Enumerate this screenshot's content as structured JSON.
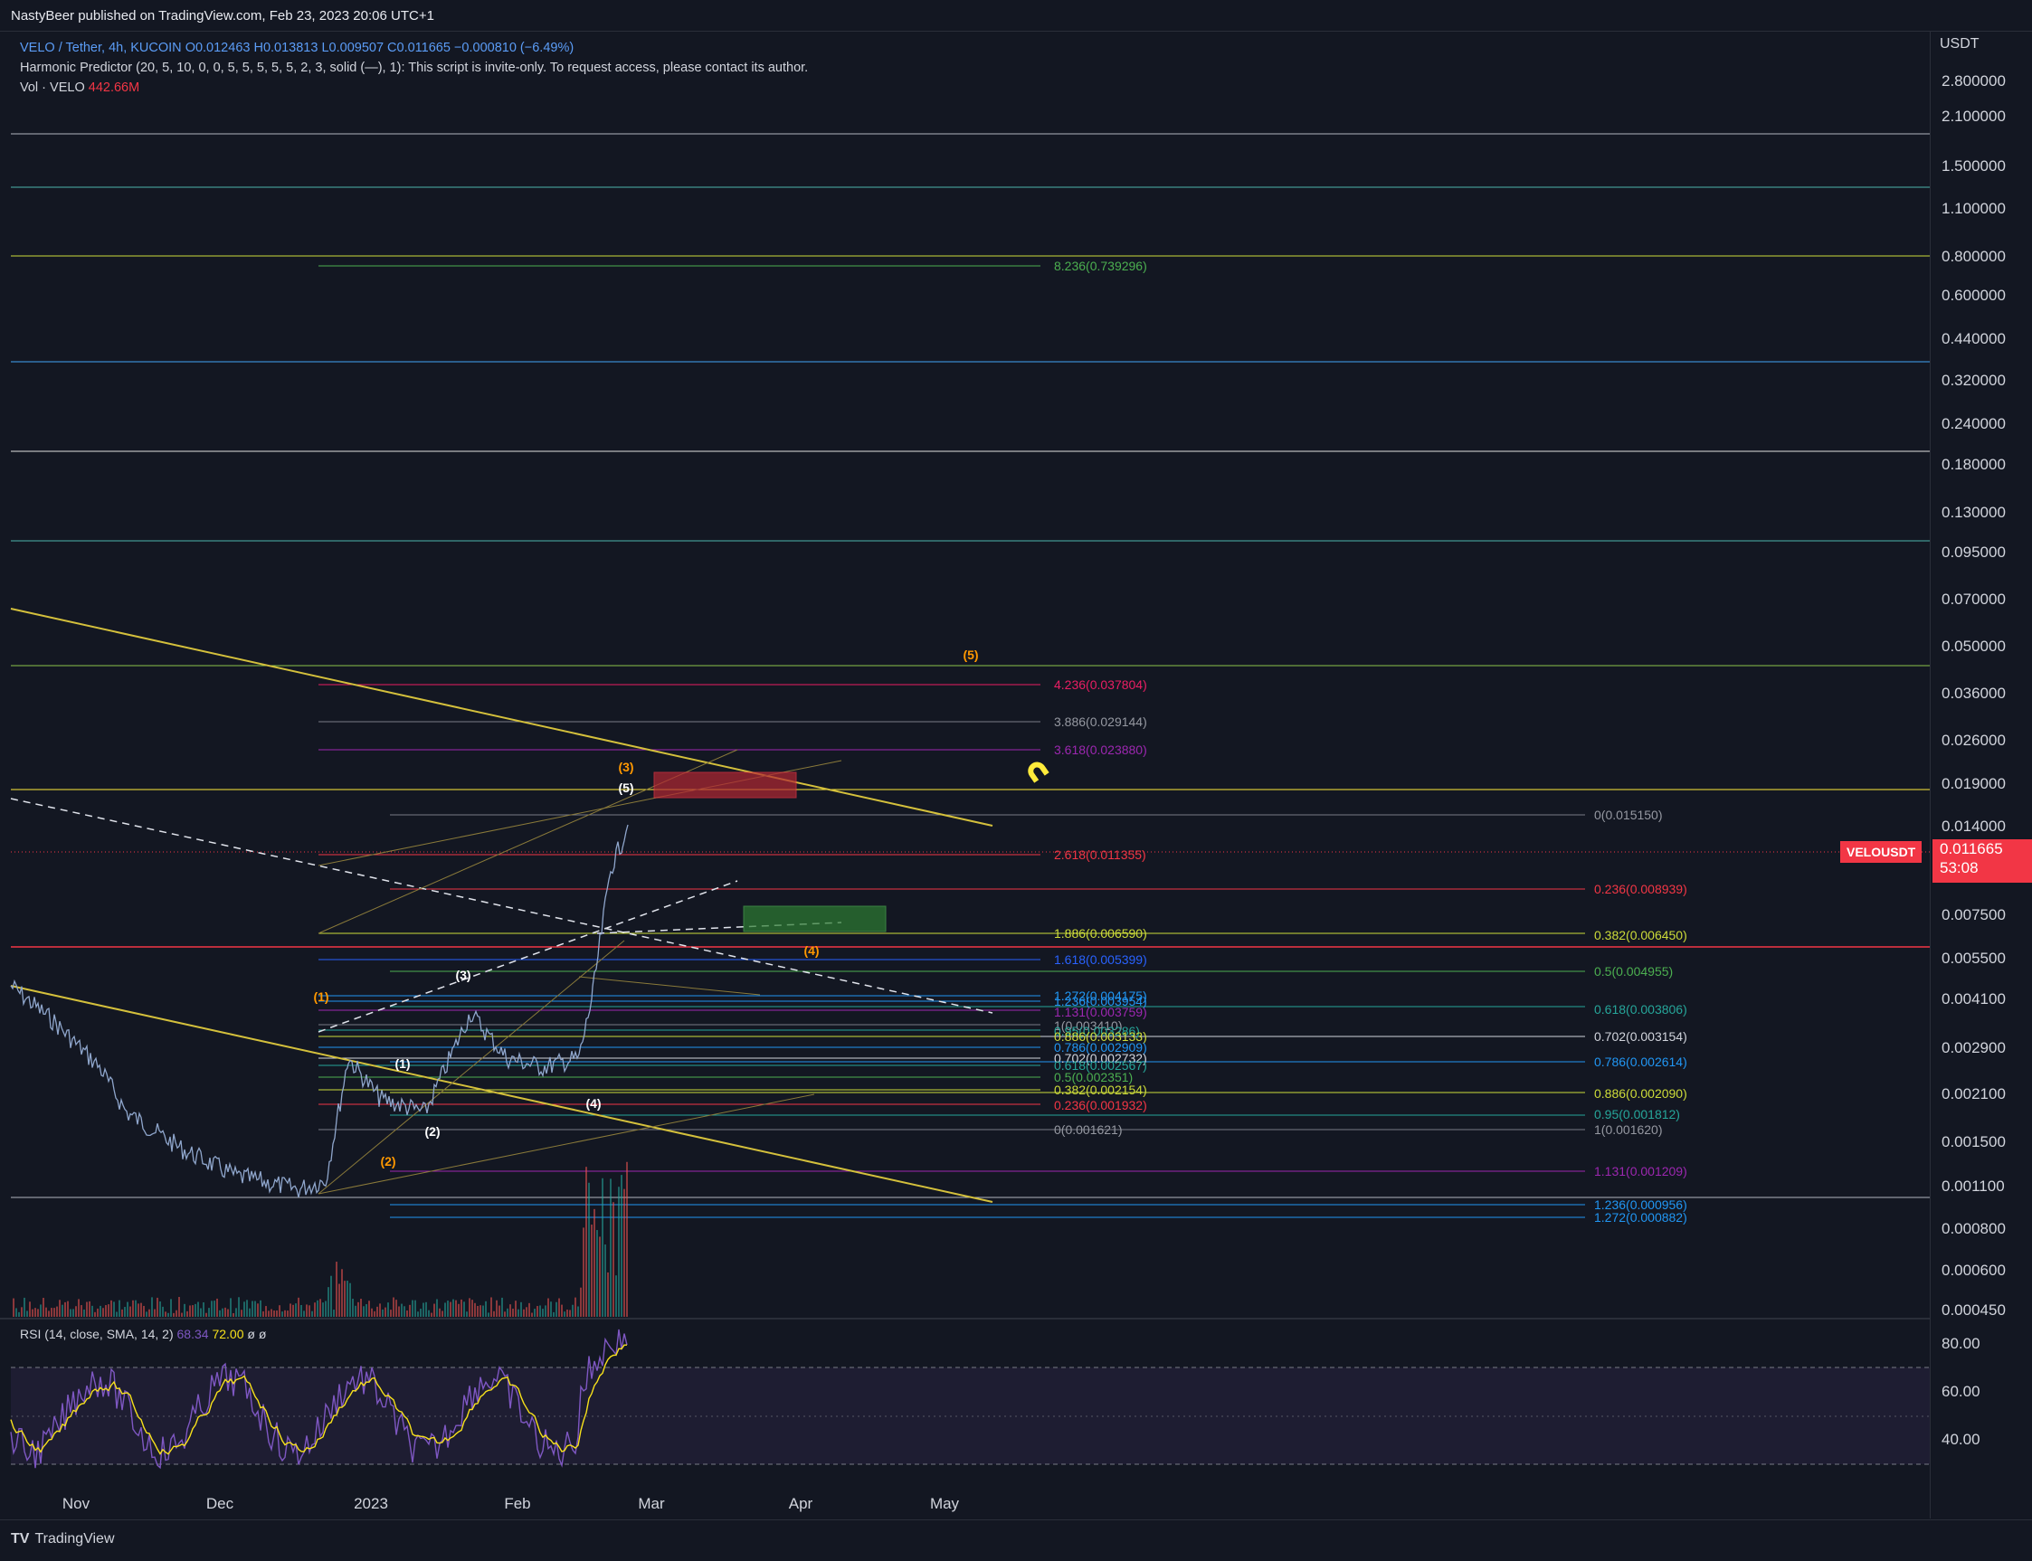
{
  "header": {
    "published": "NastyBeer published on TradingView.com, Feb 23, 2023 20:06 UTC+1"
  },
  "legend": {
    "symbol": "VELO / Tether, 4h, KUCOIN",
    "open": "O0.012463",
    "high": "H0.013813",
    "low": "L0.009507",
    "close": "C0.011665",
    "change": "−0.000810 (−6.49%)",
    "indicator": "Harmonic Predictor (20, 5, 10, 0, 0, 5, 5, 5, 5, 5, 2, 3, solid (—), 1): This script is invite-only. To request access, please contact its author.",
    "vol_label": "Vol · VELO",
    "vol_value": "442.66M"
  },
  "price_axis": {
    "currency": "USDT",
    "ticks": [
      "2.800000",
      "2.100000",
      "1.500000",
      "1.100000",
      "0.800000",
      "0.600000",
      "0.440000",
      "0.320000",
      "0.240000",
      "0.180000",
      "0.130000",
      "0.095000",
      "0.070000",
      "0.050000",
      "0.036000",
      "0.026000",
      "0.019000",
      "0.014000",
      "0.007500",
      "0.005500",
      "0.004100",
      "0.002900",
      "0.002100",
      "0.001500",
      "0.001100",
      "0.000800",
      "0.000600",
      "0.000450"
    ],
    "current_price": "0.011665",
    "countdown": "53:08",
    "symbol_tag": "VELOUSDT"
  },
  "rsi": {
    "label": "RSI (14, close, SMA, 14, 2)",
    "value": "68.34",
    "sma": "72.00",
    "extra": "ø  ø",
    "ticks": [
      "80.00",
      "60.00",
      "40.00"
    ]
  },
  "time_axis": [
    "Nov",
    "Dec",
    "2023",
    "Feb",
    "Mar",
    "Apr",
    "May"
  ],
  "fib_labels": [
    {
      "text": "8.236(0.739296)",
      "color": "#4caf50"
    },
    {
      "text": "4.236(0.037804)",
      "color": "#e91e63"
    },
    {
      "text": "3.886(0.029144)",
      "color": "#9598a1"
    },
    {
      "text": "3.618(0.023880)",
      "color": "#9c27b0"
    },
    {
      "text": "0(0.015150)",
      "color": "#9598a1"
    },
    {
      "text": "2.618(0.011355)",
      "color": "#f23645"
    },
    {
      "text": "0.236(0.008939)",
      "color": "#f23645"
    },
    {
      "text": "1.886(0.006590)",
      "color": "#cddc39"
    },
    {
      "text": "0.382(0.006450)",
      "color": "#cddc39"
    },
    {
      "text": "1.618(0.005399)",
      "color": "#2962ff"
    },
    {
      "text": "0.5(0.004955)",
      "color": "#4caf50"
    },
    {
      "text": "1.272(0.004175)",
      "color": "#2196f3"
    },
    {
      "text": "1.236(0.003954)",
      "color": "#2196f3"
    },
    {
      "text": "0.618(0.003806)",
      "color": "#26a69a"
    },
    {
      "text": "1.131(0.003759)",
      "color": "#9c27b0"
    },
    {
      "text": "1(0.003410)",
      "color": "#9598a1"
    },
    {
      "text": "0.95(0.003286)",
      "color": "#26a69a"
    },
    {
      "text": "0.886(0.003133)",
      "color": "#cddc39"
    },
    {
      "text": "0.702(0.003154)",
      "color": "#d1d4dc"
    },
    {
      "text": "0.786(0.002909)",
      "color": "#2196f3"
    },
    {
      "text": "0.786(0.002614)",
      "color": "#2196f3"
    },
    {
      "text": "0.702(0.002732)",
      "color": "#d1d4dc"
    },
    {
      "text": "0.618(0.002567)",
      "color": "#26a69a"
    },
    {
      "text": "0.5(0.002351)",
      "color": "#4caf50"
    },
    {
      "text": "0.382(0.002154)",
      "color": "#cddc39"
    },
    {
      "text": "0.886(0.002090)",
      "color": "#cddc39"
    },
    {
      "text": "0.236(0.001932)",
      "color": "#f23645"
    },
    {
      "text": "0.95(0.001812)",
      "color": "#26a69a"
    },
    {
      "text": "0(0.001621)",
      "color": "#9598a1"
    },
    {
      "text": "1(0.001620)",
      "color": "#9598a1"
    },
    {
      "text": "1.131(0.001209)",
      "color": "#9c27b0"
    },
    {
      "text": "1.236(0.000956)",
      "color": "#2196f3"
    },
    {
      "text": "1.272(0.000882)",
      "color": "#2196f3"
    }
  ],
  "wave_labels": [
    {
      "text": "(5)",
      "color": "#ff9800"
    },
    {
      "text": "(3)",
      "color": "#ff9800"
    },
    {
      "text": "(5)",
      "color": "#ffffff"
    },
    {
      "text": "(4)",
      "color": "#ff9800"
    },
    {
      "text": "(1)",
      "color": "#ff9800"
    },
    {
      "text": "(3)",
      "color": "#ffffff"
    },
    {
      "text": "(1)",
      "color": "#ffffff"
    },
    {
      "text": "(4)",
      "color": "#ffffff"
    },
    {
      "text": "(2)",
      "color": "#ffffff"
    },
    {
      "text": "(2)",
      "color": "#ff9800"
    }
  ],
  "brand": "TradingView"
}
